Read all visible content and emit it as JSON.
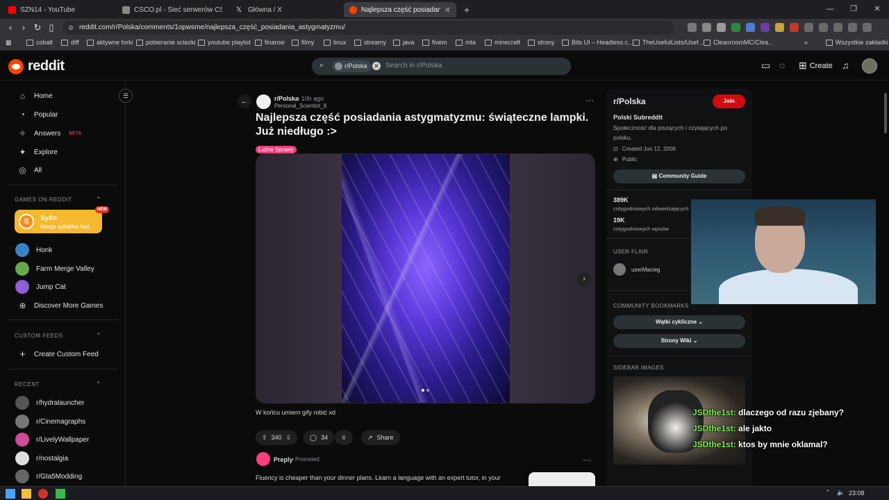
{
  "browser": {
    "tabs": [
      {
        "title": "SZN14 - YouTube",
        "color": "#ff0000"
      },
      {
        "title": "CSCO.pl - Sieć serwerów CS:Legacy",
        "color": "#888888"
      },
      {
        "title": "Główna / X",
        "color": "#e6e6e6"
      },
      {
        "title": "Najlepsza część posiadania astyg",
        "color": "#ff4500"
      }
    ],
    "new_tab_label": "+",
    "url": "reddit.com/r/Polska/comments/1opwsme/najlepsza_część_posiadania_astygmatyzmu/",
    "bookmarks": [
      "cobalt",
      "diff",
      "aktywne forki",
      "pobieranie sciezki",
      "youtube playlist",
      "finanse",
      "filmy",
      "linux",
      "streamy",
      "java",
      "fivem",
      "mta",
      "minecraft",
      "strony",
      "Bits UI – Headless c...",
      "TheUsefulLists/Usef...",
      "CleanroomMC/Clea..."
    ],
    "bookmarks_more": "»",
    "all_bookmarks": "Wszystkie zakładki"
  },
  "reddit": {
    "logo_text": "reddit",
    "search": {
      "chip_label": "r/Polska",
      "placeholder": "Search in r/Polska"
    },
    "create_label": "Create"
  },
  "left_nav": {
    "items": [
      {
        "label": "Home",
        "icon": "home-icon",
        "glyph": "⌂"
      },
      {
        "label": "Popular",
        "icon": "popular-icon",
        "glyph": "◔"
      },
      {
        "label": "Answers",
        "icon": "answers-icon",
        "glyph": "✧",
        "badge": "BETA"
      },
      {
        "label": "Explore",
        "icon": "explore-icon",
        "glyph": "✦"
      },
      {
        "label": "All",
        "icon": "all-icon",
        "glyph": "◎"
      }
    ],
    "games_header": "GAMES ON REDDIT",
    "syllo": {
      "name": "Syllo",
      "tagline": "Merge syllables fast",
      "badge": "NEW",
      "letter": "S"
    },
    "games": [
      {
        "label": "Honk",
        "color": "#3b82c4"
      },
      {
        "label": "Farm Merge Valley",
        "color": "#6aa84f"
      },
      {
        "label": "Jump Cat",
        "color": "#8e5fd6"
      },
      {
        "label": "Discover More Games",
        "color": ""
      }
    ],
    "custom_header": "CUSTOM FEEDS",
    "create_feed": "Create Custom Feed",
    "recent_header": "RECENT",
    "recent": [
      {
        "label": "r/hydralauncher",
        "color": "#555555"
      },
      {
        "label": "r/Cinemagraphs",
        "color": "#777777"
      },
      {
        "label": "r/LivelyWallpaper",
        "color": "#d04a9a"
      },
      {
        "label": "r/nostalgia",
        "color": "#dddddd"
      },
      {
        "label": "r/Gta5Modding",
        "color": "#666666"
      }
    ]
  },
  "post": {
    "subreddit": "r/Polska",
    "age": "10h ago",
    "author": "Personal_Scientist_8",
    "title": "Najlepsza część posiadania astygmatyzmu: świąteczne lampki. Już niedługo :>",
    "flair": "Luźne Sprawy",
    "caption": "W końcu umiem gify robić xd",
    "votes": "340",
    "comments": "34",
    "share_label": "Share"
  },
  "promo": {
    "name": "Preply",
    "tag": "Promoted",
    "text": "Fluency is cheaper than your dinner plans. Learn a language with an expert tutor, in your"
  },
  "sidebar": {
    "subreddit": "r/Polska",
    "join_label": "Join",
    "heading": "Polski Subreddit",
    "description": "Społeczność dla piszących i czytających po polsku.",
    "created": "Created Jun 12, 2008",
    "visibility": "Public",
    "guide_label": "Community Guide",
    "stats": [
      {
        "value": "389K",
        "label": "cotygodniowych odwiedzających"
      },
      {
        "value": "19K",
        "label": "cotygodniowych wpisów"
      }
    ],
    "user_flair_header": "USER FLAIR",
    "user_flair_name": "userMacieg",
    "bookmarks_header": "COMMUNITY BOOKMARKS",
    "bookmarks": [
      "Wątki cykliczne",
      "Strony Wiki"
    ],
    "images_header": "SIDEBAR IMAGES"
  },
  "chat": [
    {
      "user": "JSDthe1st:",
      "message": "dlaczego od razu zjebany?"
    },
    {
      "user": "JSDthe1st:",
      "message": "ale jakto"
    },
    {
      "user": "JSDthe1st:",
      "message": "ktos by mnie oklamal?"
    }
  ],
  "taskbar": {
    "clock": "23:08"
  }
}
